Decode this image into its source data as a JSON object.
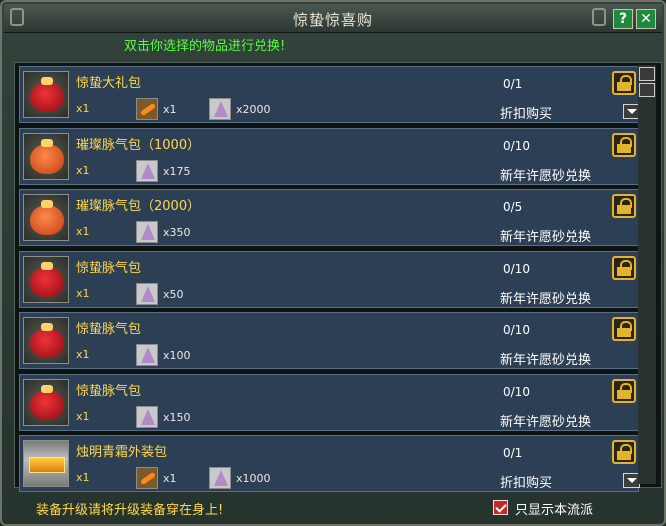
{
  "window": {
    "title": "惊蛰惊喜购",
    "help_label": "?",
    "close_label": "✕"
  },
  "instruction": "双击你选择的物品进行兑换!",
  "items": [
    {
      "name": "惊蛰大礼包",
      "qty": "x1",
      "count": "0/1",
      "method": "折扣购买",
      "icon": "red-gift-bag",
      "costs": [
        {
          "icon": "feather",
          "amount": "x1"
        },
        {
          "icon": "crystal",
          "amount": "x2000"
        }
      ],
      "dropdown": true
    },
    {
      "name": "璀璨脉气包（1000）",
      "qty": "x1",
      "count": "0/10",
      "method": "新年许愿砂兑换",
      "icon": "orange-pouch",
      "costs": [
        {
          "icon": "crystal",
          "amount": "x175"
        }
      ],
      "dropdown": false
    },
    {
      "name": "璀璨脉气包（2000）",
      "qty": "x1",
      "count": "0/5",
      "method": "新年许愿砂兑换",
      "icon": "orange-pouch",
      "costs": [
        {
          "icon": "crystal",
          "amount": "x350"
        }
      ],
      "dropdown": false
    },
    {
      "name": "惊蛰脉气包",
      "qty": "x1",
      "count": "0/10",
      "method": "新年许愿砂兑换",
      "icon": "red-gift-bag",
      "costs": [
        {
          "icon": "crystal",
          "amount": "x50"
        }
      ],
      "dropdown": false
    },
    {
      "name": "惊蛰脉气包",
      "qty": "x1",
      "count": "0/10",
      "method": "新年许愿砂兑换",
      "icon": "red-gift-bag",
      "costs": [
        {
          "icon": "crystal",
          "amount": "x100"
        }
      ],
      "dropdown": false
    },
    {
      "name": "惊蛰脉气包",
      "qty": "x1",
      "count": "0/10",
      "method": "新年许愿砂兑换",
      "icon": "red-gift-bag",
      "costs": [
        {
          "icon": "crystal",
          "amount": "x150"
        }
      ],
      "dropdown": false
    },
    {
      "name": "烛明青霜外装包",
      "qty": "x1",
      "count": "0/1",
      "method": "折扣购买",
      "icon": "golden-outfit-box",
      "costs": [
        {
          "icon": "feather",
          "amount": "x1"
        },
        {
          "icon": "crystal",
          "amount": "x1000"
        }
      ],
      "dropdown": true
    }
  ],
  "footer": {
    "hint": "装备升级请将升级装备穿在身上!",
    "checkbox_label": "只显示本流派",
    "checkbox_checked": true
  },
  "colors": {
    "item_name": "#ffd84a",
    "instruction": "#56ff3a",
    "row_bg": "#2d3f55",
    "lock": "#e3b429"
  }
}
